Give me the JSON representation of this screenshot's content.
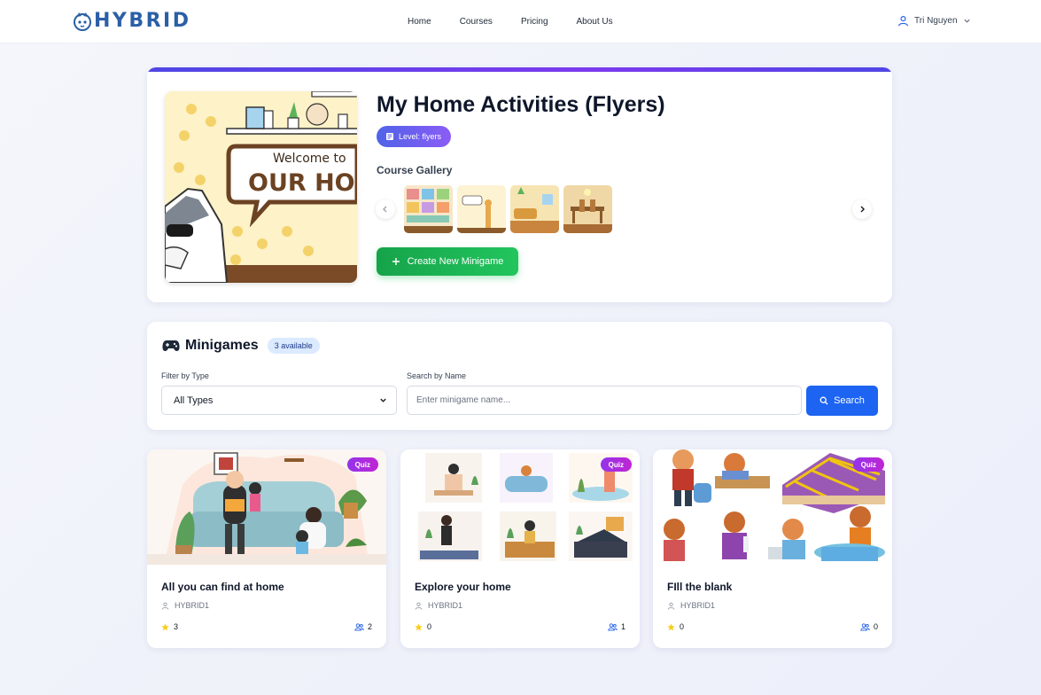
{
  "brand": {
    "name": "HYBRID",
    "color": "#2b5fa6"
  },
  "nav": {
    "links": [
      {
        "label": "Home"
      },
      {
        "label": "Courses"
      },
      {
        "label": "Pricing"
      },
      {
        "label": "About Us"
      }
    ],
    "user": {
      "name": "Tri Nguyen",
      "icon": "user-icon"
    }
  },
  "course": {
    "title": "My Home Activities (Flyers)",
    "level_label": "Level: flyers",
    "cover_text": {
      "line1": "Welcome to",
      "line2": "OUR HOME"
    },
    "gallery_label": "Course Gallery",
    "create_label": "Create New Minigame"
  },
  "minigames": {
    "title": "Minigames",
    "count_label": "3 available",
    "filter_label": "Filter by Type",
    "filter_value": "All Types",
    "search_label": "Search by Name",
    "search_placeholder": "Enter minigame name...",
    "search_button": "Search",
    "cards": [
      {
        "title": "All you can find at home",
        "author": "HYBRID1",
        "rating": "3",
        "plays": "2",
        "badge": "Quiz"
      },
      {
        "title": "Explore your home",
        "author": "HYBRID1",
        "rating": "0",
        "plays": "1",
        "badge": "Quiz"
      },
      {
        "title": "FIll the blank",
        "author": "HYBRID1",
        "rating": "0",
        "plays": "0",
        "badge": "Quiz"
      }
    ]
  },
  "colors": {
    "primary": "#1d64f2",
    "success": "#22c55e",
    "accent_gradient": "#7c3aed",
    "quiz_badge": "#a21caf",
    "star": "#facc15"
  }
}
